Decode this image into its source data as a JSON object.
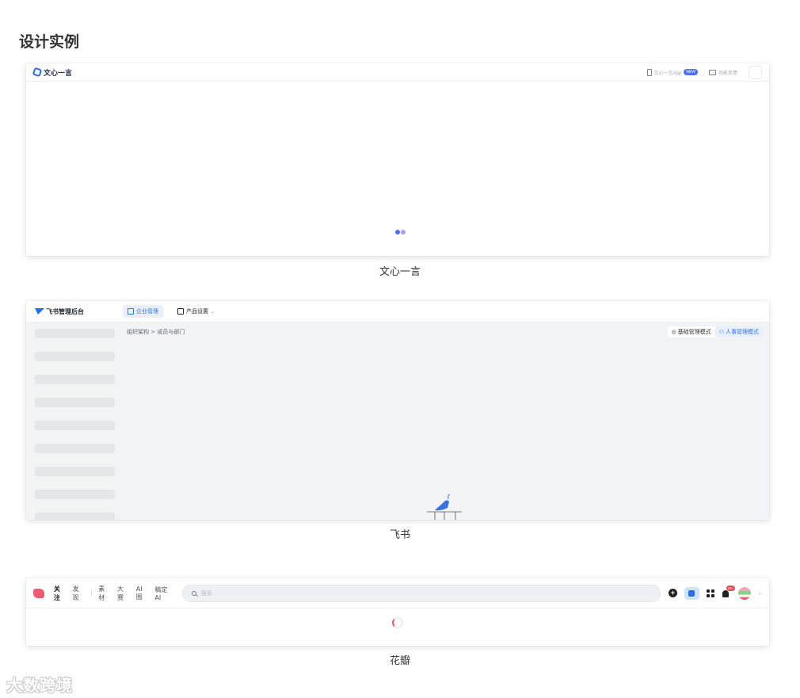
{
  "page_title": "设计实例",
  "wenxin": {
    "caption": "文心一言",
    "logo_text": "文心一言",
    "app_link": "文心一言App",
    "new_badge": "NEW",
    "feedback": "功能反馈",
    "loader_colors": [
      "#4a6cf7",
      "#a99cf5"
    ]
  },
  "feishu": {
    "caption": "飞书",
    "logo_text": "飞书管理后台",
    "tabs": [
      {
        "label": "企业管理",
        "active": true
      },
      {
        "label": "产品设置",
        "active": false
      }
    ],
    "breadcrumb": "组织架构 > 成员与部门",
    "modes": [
      {
        "label": "基础管理模式",
        "selected": false
      },
      {
        "label": "人事管理模式",
        "selected": true
      }
    ],
    "loader_colors": [
      "#2ec7a0",
      "#f5b700",
      "#3370ff"
    ],
    "bird_color": "#3a6fe0"
  },
  "huaban": {
    "caption": "花瓣",
    "nav": [
      {
        "label": "关注",
        "active": true
      },
      {
        "label": "发现",
        "active": false
      },
      {
        "label": "素材",
        "active": false
      },
      {
        "label": "大赛",
        "active": false
      },
      {
        "label": "AI圈",
        "active": false
      },
      {
        "label": "稿定AI",
        "active": false
      }
    ],
    "search_placeholder": "搜索",
    "notification_count": "99+",
    "brand_color": "#ec5b6e"
  },
  "watermark": "大数跨境"
}
